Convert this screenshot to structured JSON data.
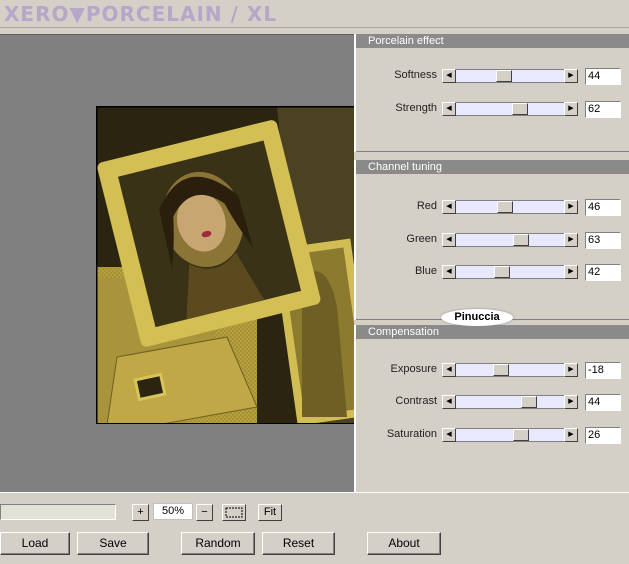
{
  "app": {
    "title": "XERO▼PORCELAIN / XL"
  },
  "panels": {
    "porcelain": {
      "title": "Porcelain effect",
      "sliders": [
        {
          "label": "Softness",
          "value": "44",
          "fraction": 0.44
        },
        {
          "label": "Strength",
          "value": "62",
          "fraction": 0.62
        }
      ]
    },
    "channel": {
      "title": "Channel tuning",
      "sliders": [
        {
          "label": "Red",
          "value": "46",
          "fraction": 0.46
        },
        {
          "label": "Green",
          "value": "63",
          "fraction": 0.63
        },
        {
          "label": "Blue",
          "value": "42",
          "fraction": 0.42
        }
      ]
    },
    "compensation": {
      "title": "Compensation",
      "sliders": [
        {
          "label": "Exposure",
          "value": "-18",
          "fraction": 0.41
        },
        {
          "label": "Contrast",
          "value": "44",
          "fraction": 0.72
        },
        {
          "label": "Saturation",
          "value": "26",
          "fraction": 0.63
        }
      ]
    }
  },
  "watermark": "Pinuccia",
  "toolbar": {
    "zoom_in": "+",
    "zoom_value": "50%",
    "zoom_out": "−",
    "actual_size_icon": "actual-size-icon",
    "fit_label": "Fit",
    "load_label": "Load",
    "save_label": "Save",
    "random_label": "Random",
    "reset_label": "Reset",
    "about_label": "About"
  },
  "colors": {
    "panel_header_bg": "#8a8a8a",
    "slider_track": "#e8e8ff",
    "preview_bg": "#808080",
    "image_gold": "#c7b14a"
  }
}
